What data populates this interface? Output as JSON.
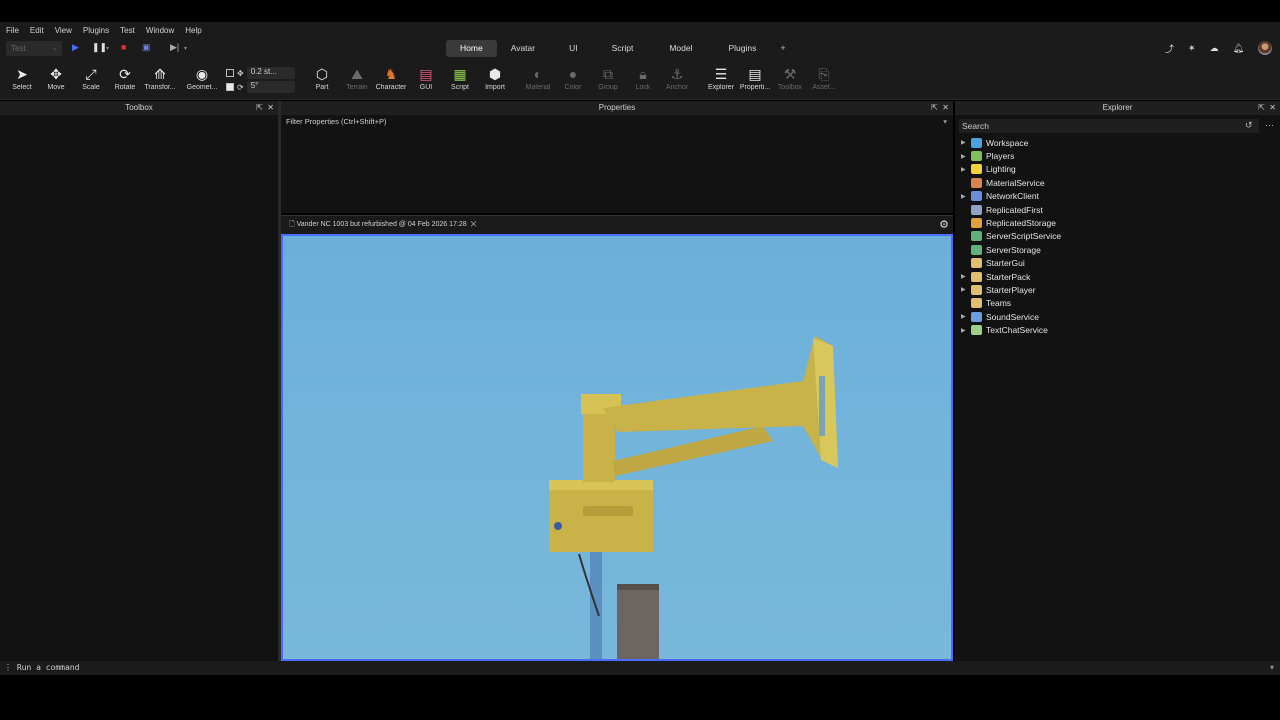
{
  "menu": [
    "File",
    "Edit",
    "View",
    "Plugins",
    "Test",
    "Window",
    "Help"
  ],
  "test_dropdown": "Test",
  "tabs": [
    "Home",
    "Avatar",
    "UI",
    "Script",
    "Model",
    "Plugins"
  ],
  "active_tab": "Home",
  "tab_plus": "+",
  "tools": {
    "select": "Select",
    "move": "Move",
    "scale": "Scale",
    "rotate": "Rotate",
    "transform": "Transfor...",
    "geometry": "Geomet...",
    "part": "Part",
    "terrain": "Terrain",
    "character": "Character",
    "gui": "GUI",
    "script": "Script",
    "import": "Import",
    "material": "Material",
    "color": "Color",
    "group": "Group",
    "lock": "Lock",
    "anchor": "Anchor",
    "explorer": "Explorer",
    "properties": "Properti...",
    "toolbox": "Toolbox",
    "asset": "Asset..."
  },
  "snap": {
    "move": "0.2 st...",
    "rotate": "5°"
  },
  "panels": {
    "toolbox": "Toolbox",
    "properties": "Properties",
    "explorer": "Explorer",
    "filter_placeholder": "Filter Properties (Ctrl+Shift+P)",
    "search_placeholder": "Search"
  },
  "explorer_items": [
    {
      "label": "Workspace",
      "expandable": true,
      "color": "#4aa3df"
    },
    {
      "label": "Players",
      "expandable": true,
      "color": "#7fbf5a"
    },
    {
      "label": "Lighting",
      "expandable": true,
      "color": "#f2d13a"
    },
    {
      "label": "MaterialService",
      "expandable": false,
      "color": "#d9844f"
    },
    {
      "label": "NetworkClient",
      "expandable": true,
      "color": "#6a8fd8"
    },
    {
      "label": "ReplicatedFirst",
      "expandable": false,
      "color": "#8fa3c7"
    },
    {
      "label": "ReplicatedStorage",
      "expandable": false,
      "color": "#e0a040"
    },
    {
      "label": "ServerScriptService",
      "expandable": false,
      "color": "#5fb37a"
    },
    {
      "label": "ServerStorage",
      "expandable": false,
      "color": "#5fb37a"
    },
    {
      "label": "StarterGui",
      "expandable": false,
      "color": "#e0c070"
    },
    {
      "label": "StarterPack",
      "expandable": true,
      "color": "#e0c070"
    },
    {
      "label": "StarterPlayer",
      "expandable": true,
      "color": "#e0c070"
    },
    {
      "label": "Teams",
      "expandable": false,
      "color": "#e0c070"
    },
    {
      "label": "SoundService",
      "expandable": true,
      "color": "#6aa0e0"
    },
    {
      "label": "TextChatService",
      "expandable": true,
      "color": "#9fd08a"
    }
  ],
  "viewport_tab": "Vander NC 1003 but refurbished @ 04 Feb 2026 17:28",
  "command_placeholder": "Run a command",
  "colors": {
    "viewport_border": "#4a6cff",
    "sky": "#6fb1d6",
    "siren": "#c8b24a"
  }
}
